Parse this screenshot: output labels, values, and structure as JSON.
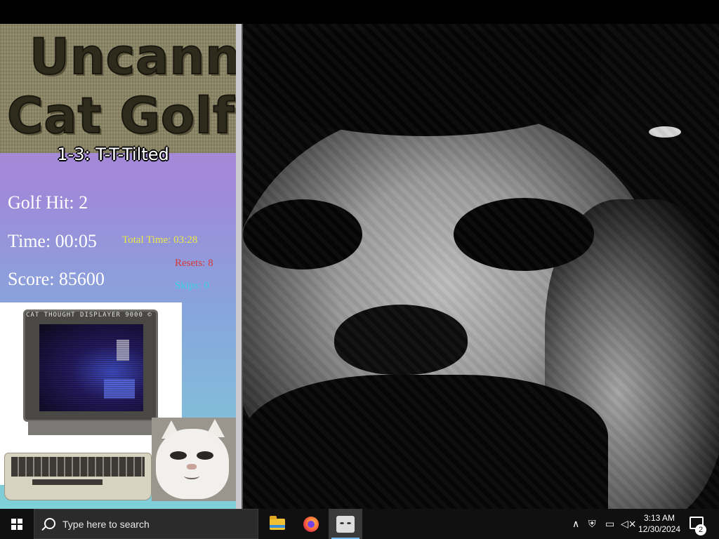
{
  "game": {
    "logo_line1": "Uncanny",
    "logo_line2": "Cat Golf",
    "level_title": "1-3: T-T-Tilted",
    "golf_hit": "Golf Hit: 2",
    "time": "Time: 00:05",
    "score": "Score: 85600",
    "total_time": "Total Time: 03:28",
    "resets": "Resets: 8",
    "skips": "Skips: 0",
    "crt_label": "CAT THOUGHT DISPLAYER 9000 ©"
  },
  "colors": {
    "total_time": "#e8e84a",
    "resets": "#d23a3a",
    "skips": "#3fd0e8"
  },
  "taskbar": {
    "search_placeholder": "Type here to search",
    "apps": [
      "file-explorer-icon",
      "firefox-icon",
      "uncanny-cat-golf-icon"
    ],
    "clock_time": "3:13 AM",
    "clock_date": "12/30/2024",
    "notification_count": "2"
  }
}
